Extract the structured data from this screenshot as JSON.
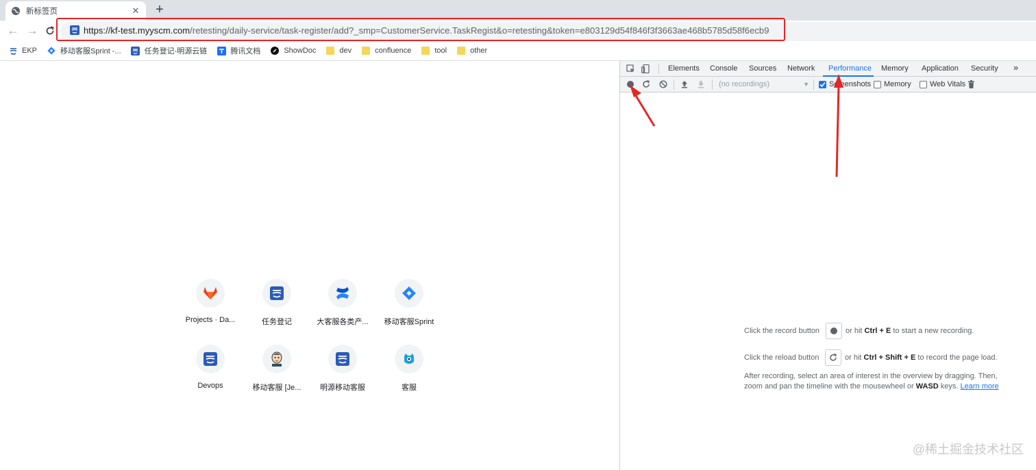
{
  "tab": {
    "title": "新标签页",
    "close": "✕",
    "new": "+"
  },
  "toolbar": {
    "back": "←",
    "forward": "→",
    "reload": "C",
    "url_host": "https://kf-test.myyscm.com",
    "url_path": "/retesting/daily-service/task-register/add?_smp=CustomerService.TaskRegist&o=retesting&token=e803129d54f846f3f3663ae468b5785d58f6ecb9"
  },
  "bookmarks": [
    {
      "label": "EKP",
      "icon": "mingyuan-icon"
    },
    {
      "label": "移动客服Sprint -...",
      "icon": "jira-icon"
    },
    {
      "label": "任务登记-明源云链",
      "icon": "mingyuan-icon"
    },
    {
      "label": "腾讯文档",
      "icon": "tencent-docs-icon"
    },
    {
      "label": "ShowDoc",
      "icon": "showdoc-icon"
    },
    {
      "label": "dev",
      "icon": "folder-icon"
    },
    {
      "label": "confluence",
      "icon": "folder-icon"
    },
    {
      "label": "tool",
      "icon": "folder-icon"
    },
    {
      "label": "other",
      "icon": "folder-icon"
    }
  ],
  "shortcuts": [
    {
      "label": "Projects · Da...",
      "icon": "gitlab-icon"
    },
    {
      "label": "任务登记",
      "icon": "mingyuan-icon"
    },
    {
      "label": "大客服各类产...",
      "icon": "confluence-icon"
    },
    {
      "label": "移动客服Sprint",
      "icon": "jira-icon"
    },
    {
      "label": "Devops",
      "icon": "mingyuan-icon"
    },
    {
      "label": "移动客服 [Je...",
      "icon": "jenkins-icon"
    },
    {
      "label": "明源移动客服",
      "icon": "mingyuan-icon"
    },
    {
      "label": "客服",
      "icon": "mascot-icon"
    }
  ],
  "devtools": {
    "tabs": [
      "Elements",
      "Console",
      "Sources",
      "Network",
      "Performance",
      "Memory",
      "Application",
      "Security"
    ],
    "active_tab": "Performance",
    "more": "»",
    "recordings_placeholder": "(no recordings)",
    "checkboxes": [
      {
        "label": "Screenshots",
        "checked": true
      },
      {
        "label": "Memory",
        "checked": false
      },
      {
        "label": "Web Vitals",
        "checked": false
      }
    ],
    "help": {
      "record_pre": "Click the record button",
      "record_mid": "or hit",
      "record_keys": "Ctrl + E",
      "record_post": "to start a new recording.",
      "reload_pre": "Click the reload button",
      "reload_mid": "or hit",
      "reload_keys": "Ctrl + Shift + E",
      "reload_post": "to record the page load.",
      "after_line1": "After recording, select an area of interest in the overview by dragging. Then,",
      "after_line2_pre": "zoom and pan the timeline with the mousewheel or",
      "after_line2_keys": "WASD",
      "after_line2_post": "keys.",
      "learn_more": "Learn more"
    }
  },
  "watermark": "@稀土掘金技术社区",
  "colors": {
    "annotation": "#e62525",
    "accent": "#1a73e8"
  }
}
